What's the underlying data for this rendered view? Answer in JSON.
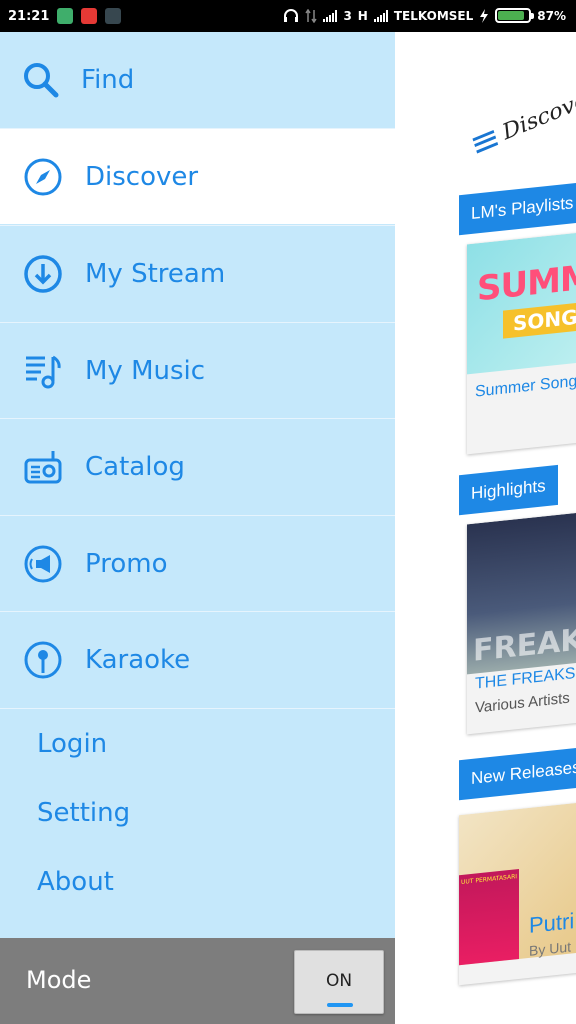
{
  "status_bar": {
    "time": "21:21",
    "network": "3",
    "network2": "H",
    "carrier": "TELKOMSEL",
    "battery": "87%",
    "battery_level": 0.87,
    "icons": [
      "shield-icon",
      "notification-icon",
      "bbm-icon",
      "headphones-icon",
      "data-arrows-icon",
      "signal-icon",
      "charging-icon",
      "battery-icon"
    ]
  },
  "drawer": {
    "find": {
      "label": "Find",
      "icon": "search-icon"
    },
    "items": [
      {
        "label": "Discover",
        "icon": "compass-icon",
        "active": true
      },
      {
        "label": "My Stream",
        "icon": "download-circle-icon",
        "active": false
      },
      {
        "label": "My Music",
        "icon": "music-list-icon",
        "active": false
      },
      {
        "label": "Catalog",
        "icon": "radio-icon",
        "active": false
      },
      {
        "label": "Promo",
        "icon": "megaphone-icon",
        "active": false
      },
      {
        "label": "Karaoke",
        "icon": "microphone-icon",
        "active": false
      }
    ],
    "links": [
      "Login",
      "Setting",
      "About"
    ],
    "mode": {
      "label": "Mode",
      "toggle": "ON"
    }
  },
  "background": {
    "title": "Discover",
    "sections": [
      {
        "label": "LM's Playlists",
        "card_title": "Summer Song",
        "art_word": "SUMM",
        "art_banner": "SONG"
      },
      {
        "label": "Highlights",
        "card_title": "THE FREAKS",
        "card_subtitle": "Various Artists",
        "art_word": "FREAK"
      },
      {
        "label": "New Releases",
        "card_title": "Putri",
        "card_subtitle": "By Uut",
        "cover_text": "UUT PERMATASARI"
      }
    ]
  },
  "colors": {
    "accent": "#1e88e5",
    "drawer_bg": "#c5e8fb",
    "active_bg": "#ffffff",
    "mode_bar": "#7d7d7d",
    "toggle_indicator": "#2196f3"
  }
}
